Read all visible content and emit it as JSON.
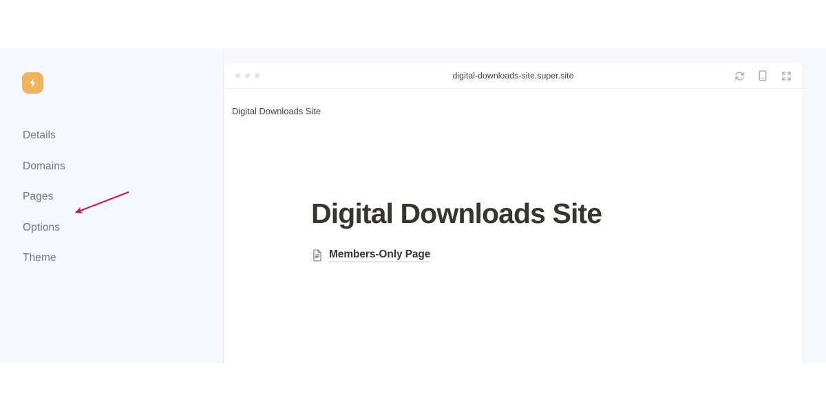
{
  "app": {
    "brand_icon": "lightning-bolt-icon",
    "brand_color": "#EFB45C"
  },
  "sidebar": {
    "items": [
      {
        "label": "Details",
        "name": "details"
      },
      {
        "label": "Domains",
        "name": "domains"
      },
      {
        "label": "Pages",
        "name": "pages"
      },
      {
        "label": "Options",
        "name": "options"
      },
      {
        "label": "Theme",
        "name": "theme"
      }
    ]
  },
  "annotation": {
    "target_label": "Domains",
    "arrow_color": "#C2185B"
  },
  "browser": {
    "url": "digital-downloads-site.super.site",
    "traffic_lights": 3,
    "actions": [
      {
        "name": "refresh-icon",
        "label": "Refresh"
      },
      {
        "name": "mobile-preview-icon",
        "label": "Mobile preview"
      },
      {
        "name": "expand-fullscreen-icon",
        "label": "Expand"
      }
    ]
  },
  "site": {
    "breadcrumb": "Digital Downloads Site",
    "title": "Digital Downloads Site",
    "links": [
      {
        "label": "Members-Only Page",
        "icon": "document-page-icon"
      }
    ]
  }
}
